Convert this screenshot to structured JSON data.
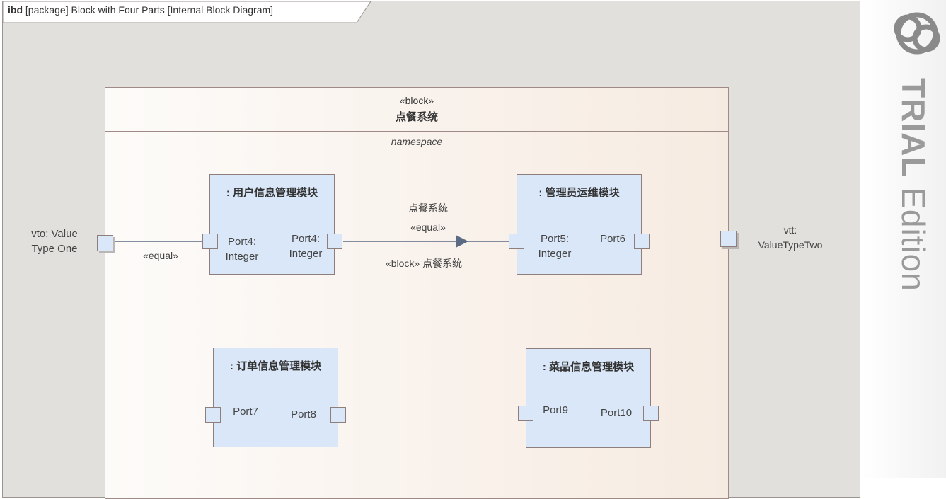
{
  "frame": {
    "kind": "ibd",
    "header_rest": "[package] Block with Four Parts [Internal Block Diagram]"
  },
  "block": {
    "stereotype": "«block»",
    "name": "点餐系统",
    "compartment": "namespace"
  },
  "parts": {
    "user": {
      "title": ": 用户信息管理模块",
      "port_left": "Port4:\nInteger",
      "port_right": "Port4:\nInteger"
    },
    "admin": {
      "title": ": 管理员运维模块",
      "port_left": "Port5:\nInteger",
      "port_right": "Port6"
    },
    "order": {
      "title": ": 订单信息管理模块",
      "port_left": "Port7",
      "port_right": "Port8"
    },
    "dish": {
      "title": ": 菜品信息管理模块",
      "port_left": "Port9",
      "port_right": "Port10"
    }
  },
  "boundary_ports": {
    "left": "vto: Value\nType One",
    "right": "vtt:\nValueTypeTwo"
  },
  "connectors": {
    "left_label": "«equal»",
    "mid_name": "点餐系统",
    "mid_stereo": "«equal»",
    "mid_type": "«block» 点餐系统"
  },
  "watermark": {
    "bold": "TRIAL",
    "rest": " Edition"
  },
  "colors": {
    "frame_bg": "#e2e0dd",
    "part_fill": "#dae7f8",
    "border": "#8f7f7c",
    "line": "#5b6b84"
  }
}
